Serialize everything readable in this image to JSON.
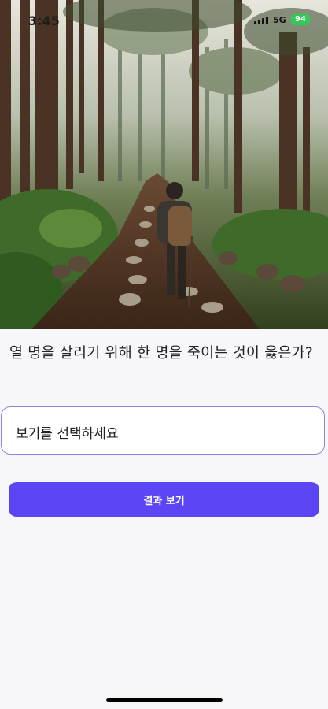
{
  "status_bar": {
    "time": "3:45",
    "network": "5G",
    "battery": "94"
  },
  "hero": {
    "icon": "forest-path-hiker-image"
  },
  "question": {
    "text": "열 명을 살리기 위해 한 명을 죽이는 것이 옳은가?"
  },
  "select": {
    "placeholder": "보기를 선택하세요"
  },
  "actions": {
    "result_label": "결과 보기"
  },
  "colors": {
    "accent": "#5c45f5",
    "select_border": "#8f82d8",
    "battery": "#34c759"
  }
}
